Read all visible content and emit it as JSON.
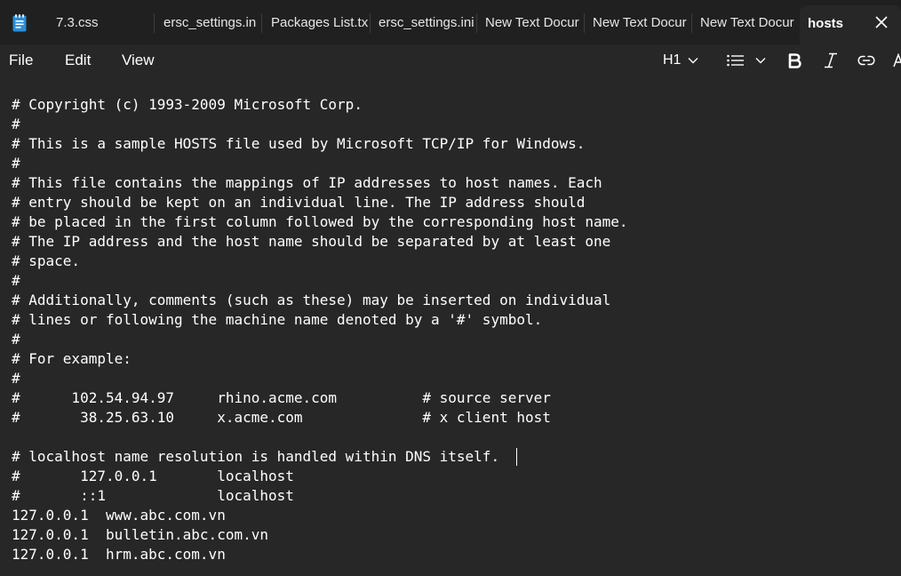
{
  "tabs": [
    {
      "label": "7.3.css"
    },
    {
      "label": "ersc_settings.in"
    },
    {
      "label": "Packages List.tx"
    },
    {
      "label": "ersc_settings.ini"
    },
    {
      "label": "New Text Docur"
    },
    {
      "label": "New Text Docur"
    },
    {
      "label": "New Text Docur"
    },
    {
      "label": "hosts",
      "active": true
    }
  ],
  "menu": {
    "file": "File",
    "edit": "Edit",
    "view": "View"
  },
  "toolbar": {
    "heading_label": "H1",
    "icons": [
      "chevron-down-icon",
      "list-icon",
      "bold-icon",
      "italic-icon",
      "link-icon",
      "font-icon"
    ]
  },
  "editor": {
    "lines": [
      "",
      "# Copyright (c) 1993-2009 Microsoft Corp.",
      "#",
      "# This is a sample HOSTS file used by Microsoft TCP/IP for Windows.",
      "#",
      "# This file contains the mappings of IP addresses to host names. Each",
      "# entry should be kept on an individual line. The IP address should",
      "# be placed in the first column followed by the corresponding host name.",
      "# The IP address and the host name should be separated by at least one",
      "# space.",
      "#",
      "# Additionally, comments (such as these) may be inserted on individual",
      "# lines or following the machine name denoted by a '#' symbol.",
      "#",
      "# For example:",
      "#",
      "#      102.54.94.97     rhino.acme.com          # source server",
      "#       38.25.63.10     x.acme.com              # x client host",
      "",
      "# localhost name resolution is handled within DNS itself.",
      "#       127.0.0.1       localhost",
      "#       ::1             localhost",
      "127.0.0.1  www.abc.com.vn",
      "127.0.0.1  bulletin.abc.com.vn",
      "127.0.0.1  hrm.abc.com.vn"
    ]
  }
}
